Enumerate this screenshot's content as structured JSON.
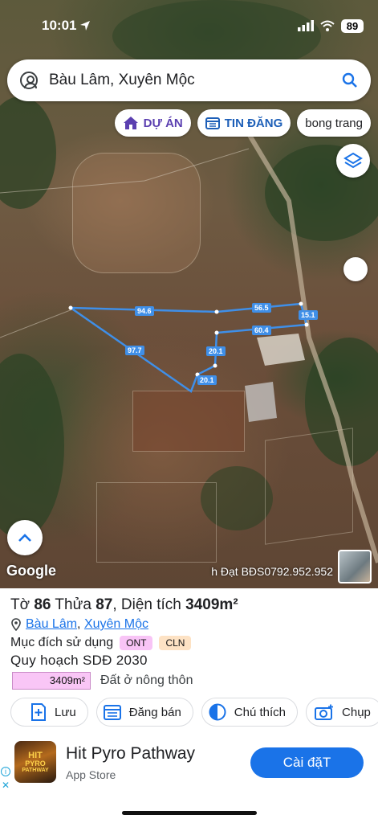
{
  "status_bar": {
    "time": "10:01",
    "battery": "89"
  },
  "search": {
    "text": "Bàu Lâm, Xuyên Mộc"
  },
  "chips": [
    {
      "label": "DỰ ÁN"
    },
    {
      "label": "TIN ĐĂNG"
    },
    {
      "label": "bong trang"
    }
  ],
  "map": {
    "google_label": "Google",
    "watermark": "h Đạt BĐS0792.952.952",
    "parcel_labels": [
      "94.6",
      "56.5",
      "15.1",
      "60.4",
      "97.7",
      "20.1",
      "20.1"
    ]
  },
  "parcel": {
    "prefix": "Tờ ",
    "sheet_no": "86",
    "mid": " Thửa ",
    "plot_no": "87",
    "area_text": ", Diện tích ",
    "area_value": "3409m²",
    "commune": "Bàu Lâm",
    "separator": ", ",
    "district": "Xuyên Mộc",
    "purpose_label": "Mục đích sử dụng",
    "tags": [
      "ONT",
      "CLN"
    ],
    "planning_label": "Quy hoạch SDĐ 2030",
    "planning_area": "3409m²",
    "planning_type": "Đất ở nông thôn"
  },
  "actions": [
    {
      "label": "Lưu"
    },
    {
      "label": "Đăng bán"
    },
    {
      "label": "Chú thích"
    },
    {
      "label": "Chụp"
    }
  ],
  "ad": {
    "logo_line1": "HIT",
    "logo_line2": "PYRO",
    "logo_line3": "PATHWAY",
    "app_name": "Hit Pyro Pathway",
    "store": "App Store",
    "install": "Cài đặT"
  },
  "colors": {
    "accent": "#1a73e8",
    "parcel_line": "#3f8fe8",
    "ont": "#f8c4f6",
    "cln": "#fde2c4"
  }
}
